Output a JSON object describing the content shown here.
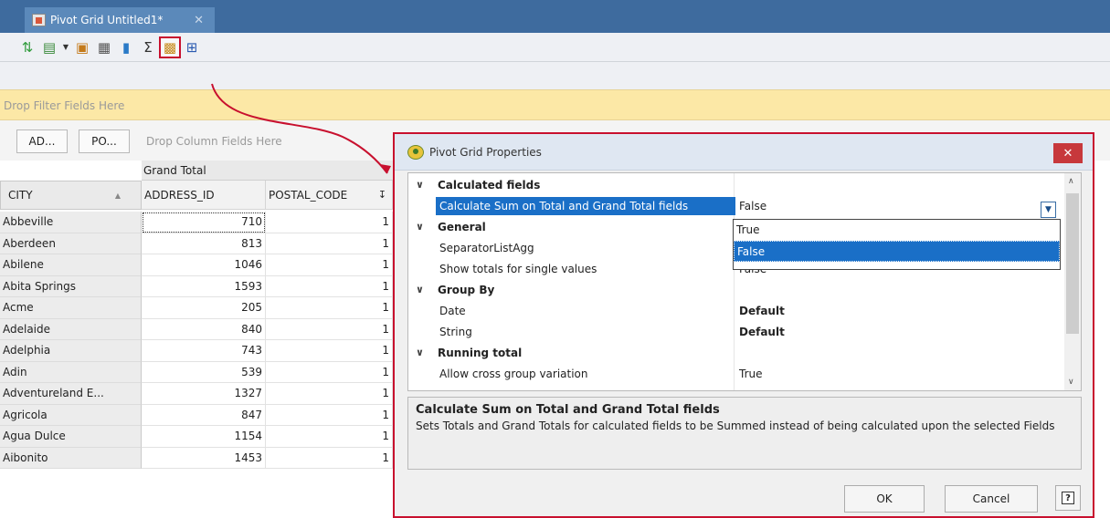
{
  "tab": {
    "title": "Pivot Grid Untitled1*",
    "close": "✕"
  },
  "toolbar": {
    "icons": [
      "refresh-icon",
      "export-icon",
      "dropdown-arrow-icon",
      "save-icon",
      "print-icon",
      "chart-icon",
      "sigma-icon",
      "properties-icon",
      "fit-icon"
    ]
  },
  "filter_area": {
    "hint": "Drop Filter Fields Here"
  },
  "column_area": {
    "row_fields": [
      "AD...",
      "PO..."
    ],
    "hint": "Drop Column Fields Here"
  },
  "grid": {
    "grand_total": "Grand Total",
    "row_header": "CITY",
    "columns": [
      "ADDRESS_ID",
      "POSTAL_CODE"
    ],
    "rows": [
      {
        "city": "Abbeville",
        "address_id": "710",
        "postal_code": "1"
      },
      {
        "city": "Aberdeen",
        "address_id": "813",
        "postal_code": "1"
      },
      {
        "city": "Abilene",
        "address_id": "1046",
        "postal_code": "1"
      },
      {
        "city": "Abita Springs",
        "address_id": "1593",
        "postal_code": "1"
      },
      {
        "city": "Acme",
        "address_id": "205",
        "postal_code": "1"
      },
      {
        "city": "Adelaide",
        "address_id": "840",
        "postal_code": "1"
      },
      {
        "city": "Adelphia",
        "address_id": "743",
        "postal_code": "1"
      },
      {
        "city": "Adin",
        "address_id": "539",
        "postal_code": "1"
      },
      {
        "city": "Adventureland E...",
        "address_id": "1327",
        "postal_code": "1"
      },
      {
        "city": "Agricola",
        "address_id": "847",
        "postal_code": "1"
      },
      {
        "city": "Agua Dulce",
        "address_id": "1154",
        "postal_code": "1"
      },
      {
        "city": "Aibonito",
        "address_id": "1453",
        "postal_code": "1"
      }
    ]
  },
  "dialog": {
    "title": "Pivot Grid Properties",
    "close": "✕",
    "categories": {
      "calculated": "Calculated fields",
      "general": "General",
      "group_by": "Group By",
      "running_total": "Running total"
    },
    "properties": {
      "calc_sum": {
        "label": "Calculate Sum on Total and Grand Total fields",
        "value": "False"
      },
      "separator": {
        "label": "SeparatorListAgg",
        "value": ""
      },
      "show_totals": {
        "label": "Show totals for single values",
        "value": "False"
      },
      "date": {
        "label": "Date",
        "value": "Default"
      },
      "string": {
        "label": "String",
        "value": "Default"
      },
      "allow_cross": {
        "label": "Allow cross group variation",
        "value": "True"
      }
    },
    "dropdown": {
      "options": [
        "True",
        "False"
      ],
      "selected": "False"
    },
    "description": {
      "title": "Calculate Sum on Total and Grand Total fields",
      "text": "Sets Totals and Grand Totals for calculated fields to be Summed instead of being calculated upon the selected Fields"
    },
    "buttons": {
      "ok": "OK",
      "cancel": "Cancel",
      "help": "?"
    }
  }
}
